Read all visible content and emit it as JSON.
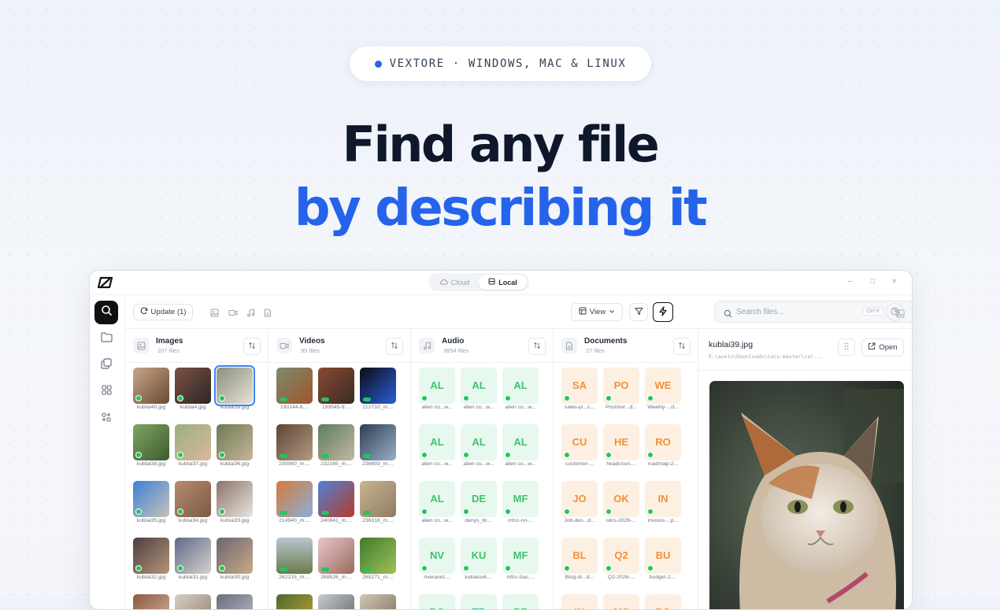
{
  "hero": {
    "pill_text": "VEXTORE · WINDOWS, MAC & LINUX",
    "line1": "Find any file",
    "line2": "by describing it"
  },
  "app": {
    "modes": [
      "Cloud",
      "Local"
    ],
    "active_mode": "Local",
    "window_controls": [
      "–",
      "□",
      "×"
    ],
    "toolbar": {
      "update_label": "Update (1)",
      "view_label": "View",
      "search_placeholder": "Search files...",
      "search_shortcut": "Ctrl K"
    },
    "columns": {
      "images": {
        "title": "Images",
        "count": "207 files",
        "files": [
          "kublai40.jpg",
          "kublai4.jpg",
          "kublai39.jpg",
          "kublai38.jpg",
          "kublai37.jpg",
          "kublai36.jpg",
          "kublai35.jpg",
          "kublai34.jpg",
          "kublai33.jpg",
          "kublai32.jpg",
          "kublai31.jpg",
          "kublai30.jpg",
          "",
          "",
          ""
        ],
        "selected": "kublai39.jpg"
      },
      "videos": {
        "title": "Videos",
        "count": "95 files",
        "files": [
          "190144-8....",
          "199545-9....",
          "212710_m....",
          "230060_m....",
          "232165_m....",
          "236893_m....",
          "214940_m....",
          "240841_m....",
          "236316_m....",
          "262215_m....",
          "268526_m....",
          "265271_m....",
          "",
          "",
          ""
        ]
      },
      "audio": {
        "title": "Audio",
        "count": "3854 files",
        "tiles": [
          {
            "abbr": "AL",
            "name": "alien co...w..."
          },
          {
            "abbr": "AL",
            "name": "alien co...w..."
          },
          {
            "abbr": "AL",
            "name": "alien co...w..."
          },
          {
            "abbr": "AL",
            "name": "alien co...w..."
          },
          {
            "abbr": "AL",
            "name": "alien co...w..."
          },
          {
            "abbr": "AL",
            "name": "alien co...w..."
          },
          {
            "abbr": "AL",
            "name": "alien co...w..."
          },
          {
            "abbr": "DE",
            "name": "denys_br...."
          },
          {
            "abbr": "MF",
            "name": "mfcc-no-..."
          },
          {
            "abbr": "NV",
            "name": "nveravet...."
          },
          {
            "abbr": "KU",
            "name": "kuliakovk...."
          },
          {
            "abbr": "MF",
            "name": "mfcc-bac...."
          },
          {
            "abbr": "BO",
            "name": ""
          },
          {
            "abbr": "TR",
            "name": ""
          },
          {
            "abbr": "PE",
            "name": ""
          }
        ]
      },
      "documents": {
        "title": "Documents",
        "count": "27 files",
        "tiles": [
          {
            "abbr": "SA",
            "name": "sales-pi...c..."
          },
          {
            "abbr": "PO",
            "name": "Postmor...d..."
          },
          {
            "abbr": "WE",
            "name": "Weekly-...d..."
          },
          {
            "abbr": "CU",
            "name": "customer-..."
          },
          {
            "abbr": "HE",
            "name": "headcoun...."
          },
          {
            "abbr": "RO",
            "name": "roadmap-2..."
          },
          {
            "abbr": "JO",
            "name": "Job-des...d..."
          },
          {
            "abbr": "OK",
            "name": "okrs-2026-..."
          },
          {
            "abbr": "IN",
            "name": "invoice-...p..."
          },
          {
            "abbr": "BL",
            "name": "Blog-dr...d..."
          },
          {
            "abbr": "Q2",
            "name": "Q2-2026-..."
          },
          {
            "abbr": "BU",
            "name": "budget-2...."
          },
          {
            "abbr": "IN",
            "name": ""
          },
          {
            "abbr": "MS",
            "name": ""
          },
          {
            "abbr": "BO",
            "name": ""
          }
        ]
      }
    },
    "preview": {
      "filename": "kublai39.jpg",
      "path": "E:\\axeln\\Downloads\\cats-master\\cat...",
      "open_label": "Open"
    },
    "colors": {
      "accent": "#2563eb",
      "audio_tile": "#e7f8ee",
      "audio_text": "#3ec26f",
      "doc_tile": "#fdf0e2",
      "doc_text": "#f0913d",
      "status_ok": "#22c55e"
    }
  }
}
